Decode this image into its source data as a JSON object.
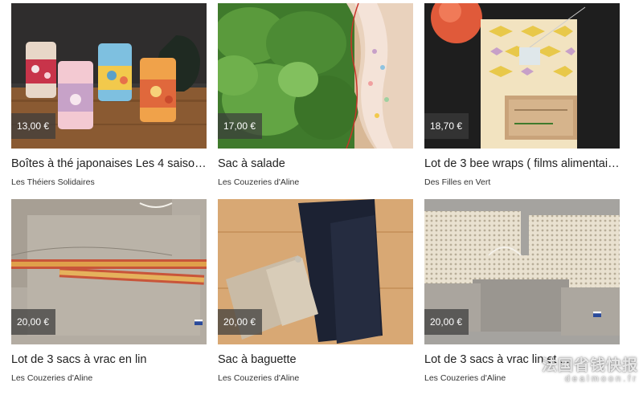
{
  "products": [
    {
      "price": "13,00 €",
      "title": "Boîtes à thé japonaises Les 4 saisons...",
      "shop": "Les Théiers Solidaires",
      "image": "tea-tins-photo"
    },
    {
      "price": "17,00 €",
      "title": "Sac à salade",
      "shop": "Les Couzeries d'Aline",
      "image": "salad-bag-photo"
    },
    {
      "price": "18,70 €",
      "title": "Lot de 3 bee wraps ( films alimentair...",
      "shop": "Des Filles en Vert",
      "image": "bee-wraps-photo"
    },
    {
      "price": "20,00 €",
      "title": "Lot de 3 sacs à vrac en lin",
      "shop": "Les Couzeries d'Aline",
      "image": "linen-bags-photo"
    },
    {
      "price": "20,00 €",
      "title": "Sac à baguette",
      "shop": "Les Couzeries d'Aline",
      "image": "baguette-bag-photo"
    },
    {
      "price": "20,00 €",
      "title": "Lot de 3 sacs à vrac lin et ...",
      "shop": "Les Couzeries d'Aline",
      "image": "mesh-bags-photo"
    }
  ],
  "watermark": {
    "cn": "法国省钱快报",
    "en": "dealmoon.fr"
  },
  "colors": {
    "price_badge": "#3c3c3c",
    "text": "#222222"
  }
}
